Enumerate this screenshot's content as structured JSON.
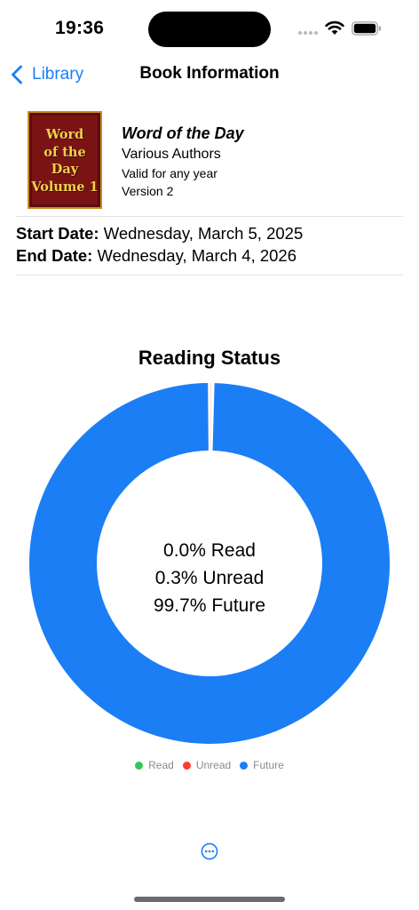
{
  "status_bar": {
    "time": "19:36"
  },
  "nav": {
    "back_label": "Library",
    "title": "Book Information"
  },
  "book": {
    "cover_text": [
      "Word",
      "of the",
      "Day",
      "Volume 1"
    ],
    "title": "Word of the Day",
    "author": "Various Authors",
    "validity": "Valid for any year",
    "version": "Version 2",
    "start_label": "Start Date:",
    "start_value": "Wednesday, March 5, 2025",
    "end_label": "End Date:",
    "end_value": "Wednesday, March 4, 2026"
  },
  "chart_data": {
    "type": "pie",
    "title": "Reading Status",
    "categories": [
      "Read",
      "Unread",
      "Future"
    ],
    "values": [
      0.0,
      0.3,
      99.7
    ],
    "colors": [
      "#34c759",
      "#ff3b30",
      "#1b7ef5"
    ],
    "center_lines": [
      "0.0% Read",
      "0.3% Unread",
      "99.7% Future"
    ],
    "legend": [
      {
        "label": "Read",
        "color": "#34c759"
      },
      {
        "label": "Unread",
        "color": "#ff3b30"
      },
      {
        "label": "Future",
        "color": "#1b7ef5"
      }
    ],
    "legend_position": "bottom"
  },
  "icons": {
    "back": "chevron-left-icon",
    "more": "ellipsis-circle-icon",
    "wifi": "wifi-icon",
    "battery": "battery-icon"
  },
  "colors": {
    "accent": "#1b7ef5"
  }
}
